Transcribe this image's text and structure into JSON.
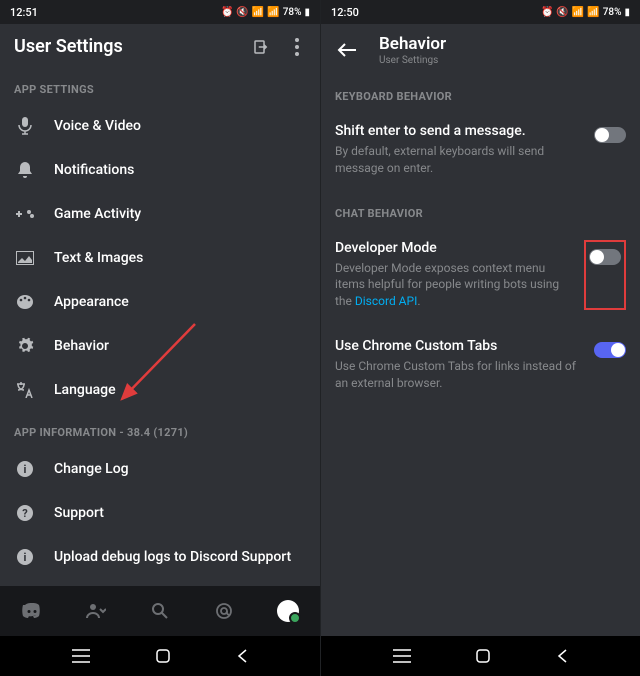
{
  "left": {
    "status": {
      "time": "12:51",
      "battery": "78%"
    },
    "header": {
      "title": "User Settings"
    },
    "appSettingsHeader": "APP SETTINGS",
    "rows": [
      {
        "label": "Voice & Video"
      },
      {
        "label": "Notifications"
      },
      {
        "label": "Game Activity"
      },
      {
        "label": "Text & Images"
      },
      {
        "label": "Appearance"
      },
      {
        "label": "Behavior"
      },
      {
        "label": "Language"
      }
    ],
    "appInfoHeader": "APP INFORMATION - 38.4 (1271)",
    "infoRows": [
      {
        "label": "Change Log"
      },
      {
        "label": "Support"
      },
      {
        "label": "Upload debug logs to Discord Support"
      }
    ]
  },
  "right": {
    "status": {
      "time": "12:50",
      "battery": "78%"
    },
    "header": {
      "title": "Behavior",
      "subtitle": "User Settings"
    },
    "kbHeader": "KEYBOARD BEHAVIOR",
    "shift": {
      "title": "Shift enter to send a message.",
      "desc": "By default, external keyboards will send message on enter."
    },
    "chatHeader": "CHAT BEHAVIOR",
    "dev": {
      "title": "Developer Mode",
      "desc1": "Developer Mode exposes context menu items helpful for people writing bots using the ",
      "link": "Discord API",
      "desc2": "."
    },
    "chrome": {
      "title": "Use Chrome Custom Tabs",
      "desc": "Use Chrome Custom Tabs for links instead of an external browser."
    }
  }
}
